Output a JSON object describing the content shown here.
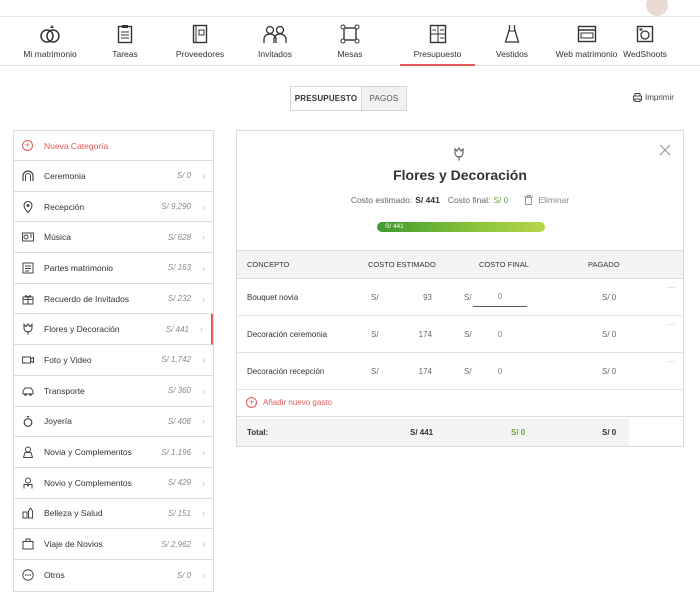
{
  "nav": {
    "items": [
      {
        "label": "Mi matrimonio",
        "icon": "rings-icon"
      },
      {
        "label": "Tareas",
        "icon": "clipboard-icon"
      },
      {
        "label": "Proveedores",
        "icon": "notebook-icon"
      },
      {
        "label": "Invitados",
        "icon": "guests-icon"
      },
      {
        "label": "Mesas",
        "icon": "table-icon"
      },
      {
        "label": "Presupuesto",
        "icon": "calculator-icon"
      },
      {
        "label": "Vestidos",
        "icon": "dress-icon"
      },
      {
        "label": "Web matrimonio",
        "icon": "website-icon"
      },
      {
        "label": "WedShoots",
        "icon": "camera-icon"
      }
    ],
    "active": "Presupuesto"
  },
  "tabs": {
    "budget": "PRESUPUESTO",
    "payments": "PAGOS"
  },
  "print_label": "Imprimir",
  "sidebar": {
    "new_category": "Nueva Categoría",
    "items": [
      {
        "label": "Ceremonia",
        "value": "S/ 0",
        "icon": "arch-icon"
      },
      {
        "label": "Recepción",
        "value": "S/ 9,290",
        "icon": "location-pin-icon"
      },
      {
        "label": "Música",
        "value": "S/ 628",
        "icon": "stereo-icon"
      },
      {
        "label": "Partes matrimonio",
        "value": "S/ 163",
        "icon": "invitation-card-icon"
      },
      {
        "label": "Recuerdo de Invitados",
        "value": "S/ 232",
        "icon": "gift-icon"
      },
      {
        "label": "Flores y Decoración",
        "value": "S/ 441",
        "icon": "flower-icon"
      },
      {
        "label": "Foto y Video",
        "value": "S/ 1,742",
        "icon": "video-camera-icon"
      },
      {
        "label": "Transporte",
        "value": "S/ 360",
        "icon": "car-icon"
      },
      {
        "label": "Joyería",
        "value": "S/ 406",
        "icon": "ring-icon"
      },
      {
        "label": "Novia y Complementos",
        "value": "S/ 1,196",
        "icon": "bride-icon"
      },
      {
        "label": "Novio y Complementos",
        "value": "S/ 429",
        "icon": "groom-icon"
      },
      {
        "label": "Belleza y Salud",
        "value": "S/ 151",
        "icon": "beauty-icon"
      },
      {
        "label": "Viaje de Novios",
        "value": "S/ 2,962",
        "icon": "suitcase-icon"
      },
      {
        "label": "Otros",
        "value": "S/ 0",
        "icon": "more-icon"
      }
    ],
    "active_index": 5
  },
  "detail": {
    "title": "Flores y Decoración",
    "estimated_label": "Costo estimado:",
    "estimated_value": "S/ 441",
    "final_label": "Costo final:",
    "final_value": "S/ 0",
    "delete_label": "Eliminar",
    "progress_label": "S/ 441",
    "columns": {
      "concept": "CONCEPTO",
      "estimated": "COSTO ESTIMADO",
      "final": "COSTO FINAL",
      "paid": "PAGADO"
    },
    "currency": "S/",
    "rows": [
      {
        "concept": "Bouquet novia",
        "estimated": "93",
        "final": "0",
        "paid": "S/ 0"
      },
      {
        "concept": "Decoración ceremonia",
        "estimated": "174",
        "final": "0",
        "paid": "S/ 0"
      },
      {
        "concept": "Decoración recepción",
        "estimated": "174",
        "final": "0",
        "paid": "S/ 0"
      }
    ],
    "row_menu": "···",
    "add_expense": "Añadir nuevo gasto",
    "total": {
      "label": "Total:",
      "estimated": "S/ 441",
      "final": "S/ 0",
      "paid": "S/ 0"
    }
  },
  "colors": {
    "accent": "#e5595b",
    "green": "#6aa537"
  }
}
